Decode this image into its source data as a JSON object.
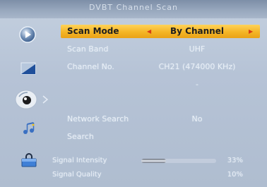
{
  "window": {
    "title": "DVBT Channel Scan"
  },
  "sidebar": {
    "icons": [
      "play-icon",
      "picture-icon",
      "search-icon",
      "music-icon",
      "lock-icon"
    ]
  },
  "menu": {
    "rows": [
      {
        "label": "Scan Mode",
        "value": "By Channel",
        "selected": true
      },
      {
        "label": "Scan Band",
        "value": "UHF"
      },
      {
        "label": "Channel No.",
        "value": "CH21 (474000 KHz)"
      },
      {
        "label": "",
        "value": "-"
      },
      {
        "label": "Network Search",
        "value": "No"
      },
      {
        "label": "Search",
        "value": ""
      }
    ]
  },
  "signal": {
    "intensity_label": "Signal Intensity",
    "intensity_value": "33%",
    "intensity_level": 0.33,
    "quality_label": "Signal Quality",
    "quality_value": "10%",
    "quality_level": 0.1
  },
  "colors": {
    "highlight": "#f4b526",
    "arrow": "#d83e14",
    "background": "#b9c6d8"
  }
}
